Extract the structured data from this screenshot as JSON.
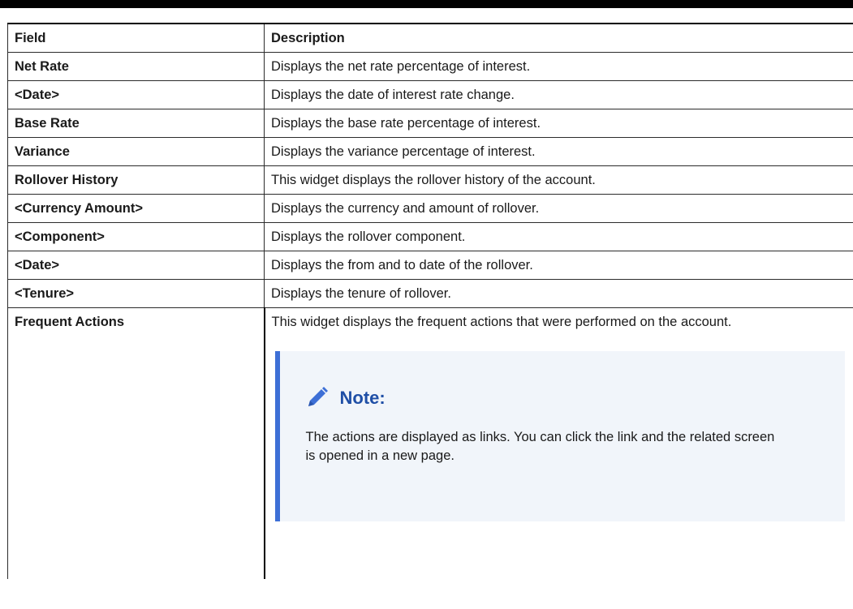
{
  "table": {
    "headers": [
      "Field",
      "Description"
    ],
    "rows": [
      {
        "field": "Net Rate",
        "description": "Displays the net rate percentage of interest."
      },
      {
        "field": "<Date>",
        "description": "Displays the date of interest rate change."
      },
      {
        "field": "Base Rate",
        "description": "Displays the base rate percentage of interest."
      },
      {
        "field": "Variance",
        "description": "Displays the variance percentage of interest."
      },
      {
        "field": "Rollover History",
        "description": "This widget displays the rollover history of the account."
      },
      {
        "field": "<Currency Amount>",
        "description": "Displays the currency and amount of rollover."
      },
      {
        "field": "<Component>",
        "description": "Displays the rollover component."
      },
      {
        "field": "<Date>",
        "description": "Displays the from and to date of the rollover."
      },
      {
        "field": "<Tenure>",
        "description": "Displays the tenure of rollover."
      },
      {
        "field": "Frequent Actions",
        "description": "This widget displays the frequent actions that were performed on the account."
      }
    ]
  },
  "note": {
    "icon": "pencil-icon",
    "title": "Note:",
    "text": "The actions are displayed as links. You can click the link and the related screen is opened in a new page.",
    "accent_color": "#3d6fd6",
    "background_color": "#f1f5fa"
  }
}
